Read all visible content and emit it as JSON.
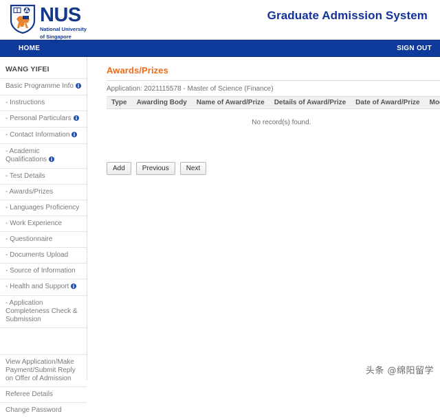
{
  "masthead": {
    "logo": {
      "name": "NUS",
      "subtitle_line1": "National University",
      "subtitle_line2": "of Singapore",
      "crest_icon": "nus-crest-icon"
    },
    "app_title": "Graduate Admission System",
    "title_color": "#14319b",
    "logo_color": "#16388a"
  },
  "navbar": {
    "home_label": "HOME",
    "signout_label": "SIGN OUT",
    "background": "#0e3a9c"
  },
  "sidebar": {
    "user_name": "WANG YIFEI",
    "items": [
      {
        "label": "Basic Programme Info",
        "info": true
      },
      {
        "label": "- Instructions",
        "info": false
      },
      {
        "label": "- Personal Particulars",
        "info": true
      },
      {
        "label": "- Contact Information",
        "info": true
      },
      {
        "label": "- Academic Qualifications",
        "info": true
      },
      {
        "label": "- Test Details",
        "info": false
      },
      {
        "label": "- Awards/Prizes",
        "info": false
      },
      {
        "label": "- Languages Proficiency",
        "info": false
      },
      {
        "label": "- Work Experience",
        "info": false
      },
      {
        "label": "- Questionnaire",
        "info": false
      },
      {
        "label": "- Documents Upload",
        "info": false
      },
      {
        "label": "- Source of Information",
        "info": false
      },
      {
        "label": "- Health and Support",
        "info": true
      },
      {
        "label": "- Application Completeness Check & Submission",
        "info": false
      }
    ],
    "bottom_items": [
      {
        "label": "View Application/Make Payment/Submit Reply on Offer of Admission"
      },
      {
        "label": "Referee Details"
      },
      {
        "label": "Change Password"
      }
    ]
  },
  "main": {
    "page_title": "Awards/Prizes",
    "page_title_color": "#ef6a18",
    "application_line": "Application: 2021115578 - Master of Science (Finance)",
    "table": {
      "headers": [
        "Type",
        "Awarding Body",
        "Name of Award/Prize",
        "Details of Award/Prize",
        "Date of Award/Prize",
        "Modify"
      ],
      "empty_message": "No record(s) found.",
      "rows": []
    },
    "buttons": [
      {
        "label": "Add",
        "name": "add-button"
      },
      {
        "label": "Previous",
        "name": "previous-button"
      },
      {
        "label": "Next",
        "name": "next-button"
      }
    ]
  },
  "watermark": {
    "text": "头条 @绵阳留学"
  }
}
